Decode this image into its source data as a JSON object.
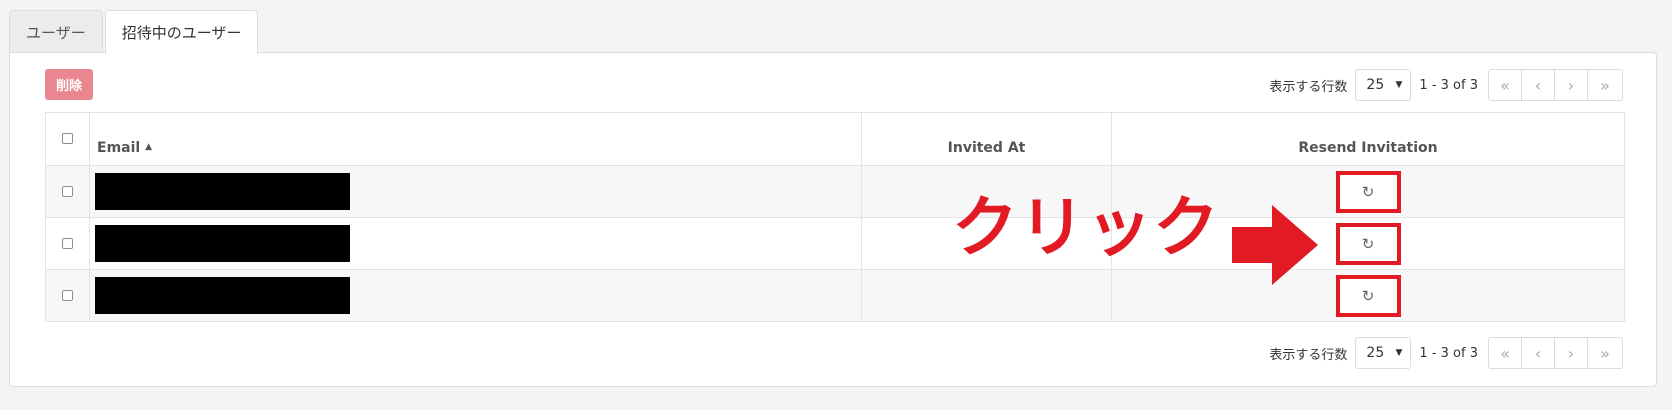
{
  "tabs": [
    {
      "label": "ユーザー",
      "active": false
    },
    {
      "label": "招待中のユーザー",
      "active": true
    }
  ],
  "toolbar": {
    "delete_label": "削除"
  },
  "pager": {
    "rows_label": "表示する行数",
    "rows_value": "25",
    "range_text": "1 - 3 of 3",
    "first_icon": "double-chevron-left-icon",
    "prev_icon": "chevron-left-icon",
    "next_icon": "chevron-right-icon",
    "last_icon": "double-chevron-right-icon"
  },
  "table": {
    "columns": {
      "email": "Email",
      "invited_at": "Invited At",
      "resend": "Resend Invitation"
    },
    "sort_icon": "sort-up-icon",
    "rows": [
      {
        "email": "[redacted]",
        "invited_at": "",
        "resend_icon": "refresh-icon"
      },
      {
        "email": "[redacted]",
        "invited_at": "",
        "resend_icon": "refresh-icon"
      },
      {
        "email": "[redacted]",
        "invited_at": "",
        "resend_icon": "refresh-icon"
      }
    ]
  },
  "annotation": {
    "text": "クリック",
    "color": "#e21a23"
  },
  "colors": {
    "delete_button": "#e9868f",
    "highlight": "#e21a23"
  }
}
